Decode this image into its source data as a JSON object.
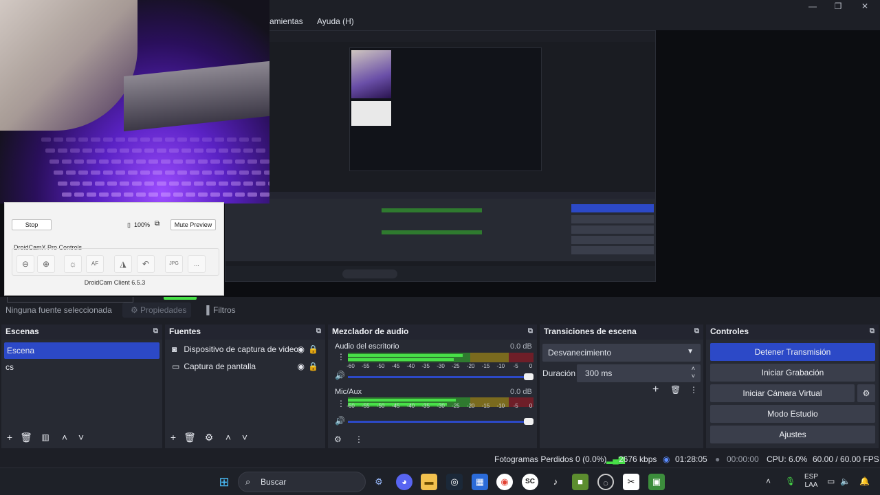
{
  "menu": {
    "tools_partial": "rramientas",
    "help": "Ayuda (H)"
  },
  "window_controls": {
    "minimize": "—",
    "maximize": "❐",
    "close": "✕"
  },
  "droidcam": {
    "stop": "Stop",
    "battery": "100%",
    "mute_preview": "Mute Preview",
    "pro_controls": "DroidCamX Pro Controls",
    "client_version": "DroidCam Client 6.5.3",
    "icons": [
      "zoom-out-icon",
      "zoom-in-icon",
      "light-icon",
      "autofocus-icon",
      "flip-icon",
      "rotate-icon",
      "jpeg-icon",
      "more-icon"
    ],
    "af_label": "AF",
    "jpg_label": "JPG",
    "more_label": "..."
  },
  "source_bar": {
    "no_source": "Ninguna fuente seleccionada",
    "properties": "Propiedades",
    "filters": "Filtros"
  },
  "scenes": {
    "title": "Escenas",
    "items": [
      "Escena",
      "cs"
    ]
  },
  "sources": {
    "title": "Fuentes",
    "items": [
      {
        "name": "Dispositivo de captura de video",
        "icon": "camera-icon"
      },
      {
        "name": "Captura de pantalla",
        "icon": "monitor-icon"
      }
    ]
  },
  "mixer": {
    "title": "Mezclador de audio",
    "channels": [
      {
        "name": "Audio del escritorio",
        "db": "0.0 dB",
        "level": 0.62
      },
      {
        "name": "Mic/Aux",
        "db": "0.0 dB",
        "level": 0.58
      }
    ],
    "ticks": [
      "-60",
      "-55",
      "-50",
      "-45",
      "-40",
      "-35",
      "-30",
      "-25",
      "-20",
      "-15",
      "-10",
      "-5",
      "0"
    ]
  },
  "transitions": {
    "title": "Transiciones de escena",
    "selected": "Desvanecimiento",
    "duration_label": "Duración",
    "duration_value": "300 ms"
  },
  "controls": {
    "title": "Controles",
    "stop_stream": "Detener Transmisión",
    "start_recording": "Iniciar Grabación",
    "start_virtual_cam": "Iniciar Cámara Virtual",
    "studio_mode": "Modo Estudio",
    "settings": "Ajustes"
  },
  "status": {
    "dropped_frames": "Fotogramas Perdidos 0 (0.0%)",
    "bitrate": "2676 kbps",
    "stream_time": "01:28:05",
    "rec_time": "00:00:00",
    "cpu": "CPU: 6.0%",
    "fps": "60.00 / 60.00 FPS"
  },
  "taskbar": {
    "search": "Buscar",
    "lang": "ESP",
    "lang_sub": "LAA"
  },
  "colors": {
    "accent": "#2c49c7",
    "panel": "#272a33",
    "meter_green": "#48e048"
  }
}
